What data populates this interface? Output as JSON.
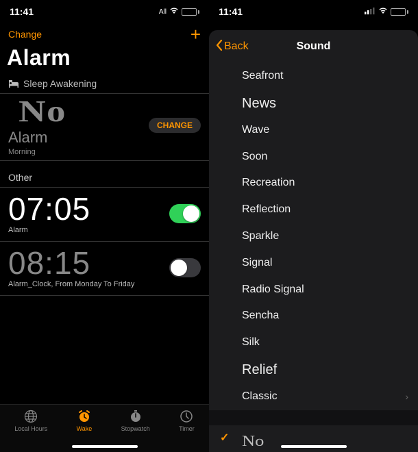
{
  "left": {
    "status": {
      "time": "11:41",
      "carrier": "All"
    },
    "edit": "Change",
    "title": "Alarm",
    "sleep_section": "Sleep Awakening",
    "no_text": "No",
    "sleep_label": "Alarm",
    "morning": "Morning",
    "change_btn": "CHANGE",
    "other_section": "Other",
    "alarms": [
      {
        "time": "07:05",
        "label": "Alarm",
        "enabled": true
      },
      {
        "time": "08:15",
        "label": "Alarm_Clock, From Monday To Friday",
        "enabled": false
      }
    ],
    "tabs": [
      {
        "label": "Local Hours",
        "active": false
      },
      {
        "label": "Wake",
        "active": true
      },
      {
        "label": "Stopwatch",
        "active": false
      },
      {
        "label": "Timer",
        "active": false
      }
    ]
  },
  "right": {
    "status": {
      "time": "11:41"
    },
    "back": "Back",
    "title": "Sound",
    "sounds": [
      {
        "name": "Seafront",
        "style": "normal"
      },
      {
        "name": "News",
        "style": "large"
      },
      {
        "name": "Wave",
        "style": "normal"
      },
      {
        "name": "Soon",
        "style": "normal"
      },
      {
        "name": "Recreation",
        "style": "normal"
      },
      {
        "name": "Reflection",
        "style": "normal"
      },
      {
        "name": "Sparkle",
        "style": "normal"
      },
      {
        "name": "Signal",
        "style": "normal"
      },
      {
        "name": "Radio Signal",
        "style": "normal"
      },
      {
        "name": "Sencha",
        "style": "normal"
      },
      {
        "name": "Silk",
        "style": "normal"
      },
      {
        "name": "Relief",
        "style": "large"
      },
      {
        "name": "Classic",
        "style": "normal",
        "chevron": true
      }
    ],
    "selected": "No"
  }
}
